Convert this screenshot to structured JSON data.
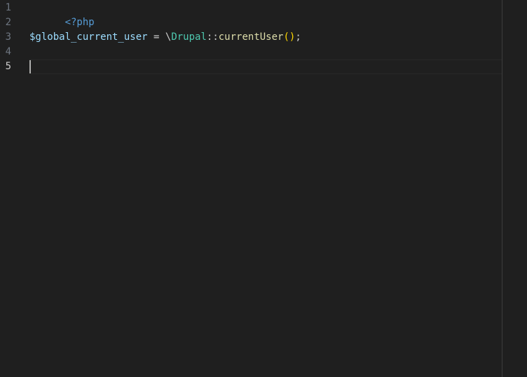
{
  "editor": {
    "language": "php",
    "active_line": "5",
    "line_numbers": [
      "1",
      "2",
      "3",
      "4",
      "5"
    ],
    "lines": {
      "l1": {
        "open_tag": "<?php"
      },
      "l3": {
        "variable": "$global_current_user",
        "assign": " = ",
        "namespace_sep": "\\",
        "class_name": "Drupal",
        "scope_op": "::",
        "method": "currentUser",
        "parens": "()",
        "semicolon": ";"
      }
    },
    "colors": {
      "background": "#1f1f1f",
      "keyword": "#569cd6",
      "variable": "#9cdcfe",
      "class": "#4ec9b0",
      "function": "#dcdcaa",
      "bracket": "#ffd700",
      "line_number": "#6e7681",
      "active_line_number": "#cccccc"
    }
  }
}
